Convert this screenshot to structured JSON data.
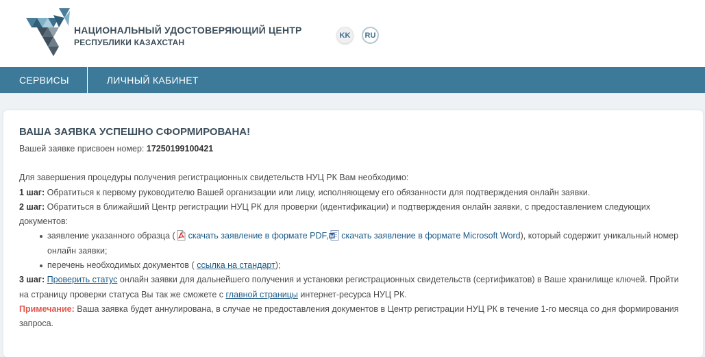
{
  "header": {
    "brand_line1": "НАЦИОНАЛЬНЫЙ УДОСТОВЕРЯЮЩИЙ ЦЕНТР",
    "brand_line2": "РЕСПУБЛИКИ КАЗАХСТАН",
    "lang_kk": "KK",
    "lang_ru": "RU"
  },
  "nav": {
    "items": [
      "СЕРВИСЫ",
      "ЛИЧНЫЙ КАБИНЕТ"
    ]
  },
  "main": {
    "title": "ВАША ЗАЯВКА УСПЕШНО СФОРМИРОВАНА!",
    "number_prefix": "Вашей заявке присвоен номер: ",
    "number": "17250199100421",
    "intro": "Для завершения процедуры получения регистрационных свидетельств НУЦ РК Вам необходимо:",
    "step1_label": "1 шаг:",
    "step1_text": " Обратиться к первому руководителю Вашей организации или лицу, исполняющему его обязанности для подтверждения онлайн заявки.",
    "step2_label": "2 шаг:",
    "step2_text": " Обратиться в ближайший Центр регистрации НУЦ РК для проверки (идентификации) и подтверждения онлайн заявки, с предоставлением следующих документов:",
    "bullet1_before": "заявление указанного образца (",
    "bullet1_pdf_link": "скачать заявление в формате PDF",
    "bullet1_sep": ",",
    "bullet1_word_link": "скачать заявление в формате Microsoft Word",
    "bullet1_after": "), который содержит уникальный номер онлайн заявки;",
    "bullet2_before": "перечень необходимых документов ( ",
    "bullet2_link": "ссылка на стандарт",
    "bullet2_after": ");",
    "step3_label": "3 шаг:",
    "step3_link": "Проверить статус",
    "step3_text1": " онлайн заявки для дальнейшего получения и установки регистрационных свидетельств (сертификатов) в Ваше хранилище ключей. Пройти на страницу проверки статуса Вы так же сможете с ",
    "step3_link2": "главной страницы",
    "step3_text2": " интернет-ресурса НУЦ РК.",
    "note_label": "Примечание:",
    "note_text": " Ваша заявка будет аннулирована, в случае не предоставления документов в Центр регистрации НУЦ РК в течение 1-го месяца со дня формирования запроса."
  },
  "colors": {
    "nav_bg": "#3d7a99",
    "brand_text": "#3d4f5c",
    "link": "#1a5a85",
    "note": "#e2574c"
  },
  "icons": [
    "logo-icon",
    "pdf-icon",
    "word-icon"
  ]
}
